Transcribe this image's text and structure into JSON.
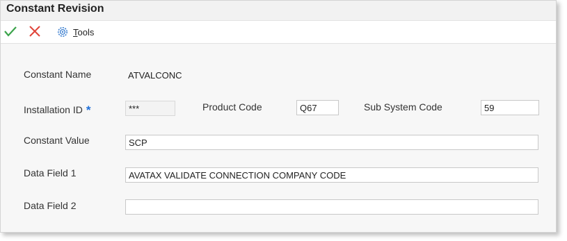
{
  "window": {
    "title": "Constant Revision"
  },
  "toolbar": {
    "ok_icon": "check-icon",
    "cancel_icon": "close-icon",
    "tools_icon": "gear-icon",
    "tools_label_accel": "T",
    "tools_label_rest": "ools"
  },
  "form": {
    "constant_name": {
      "label": "Constant Name",
      "value": "ATVALCONC"
    },
    "installation_id": {
      "label": "Installation ID",
      "required_mark": "*",
      "value": "***"
    },
    "product_code": {
      "label": "Product Code",
      "value": "Q67"
    },
    "sub_system_code": {
      "label": "Sub System Code",
      "value": "59"
    },
    "constant_value": {
      "label": "Constant Value",
      "value": "SCP"
    },
    "data_field_1": {
      "label": "Data Field 1",
      "value": "AVATAX VALIDATE CONNECTION COMPANY CODE"
    },
    "data_field_2": {
      "label": "Data Field 2",
      "value": ""
    }
  },
  "colors": {
    "check": "#3aa34a",
    "cancel": "#e0453a",
    "gear": "#3b7fd0",
    "required": "#1e6fd9"
  }
}
